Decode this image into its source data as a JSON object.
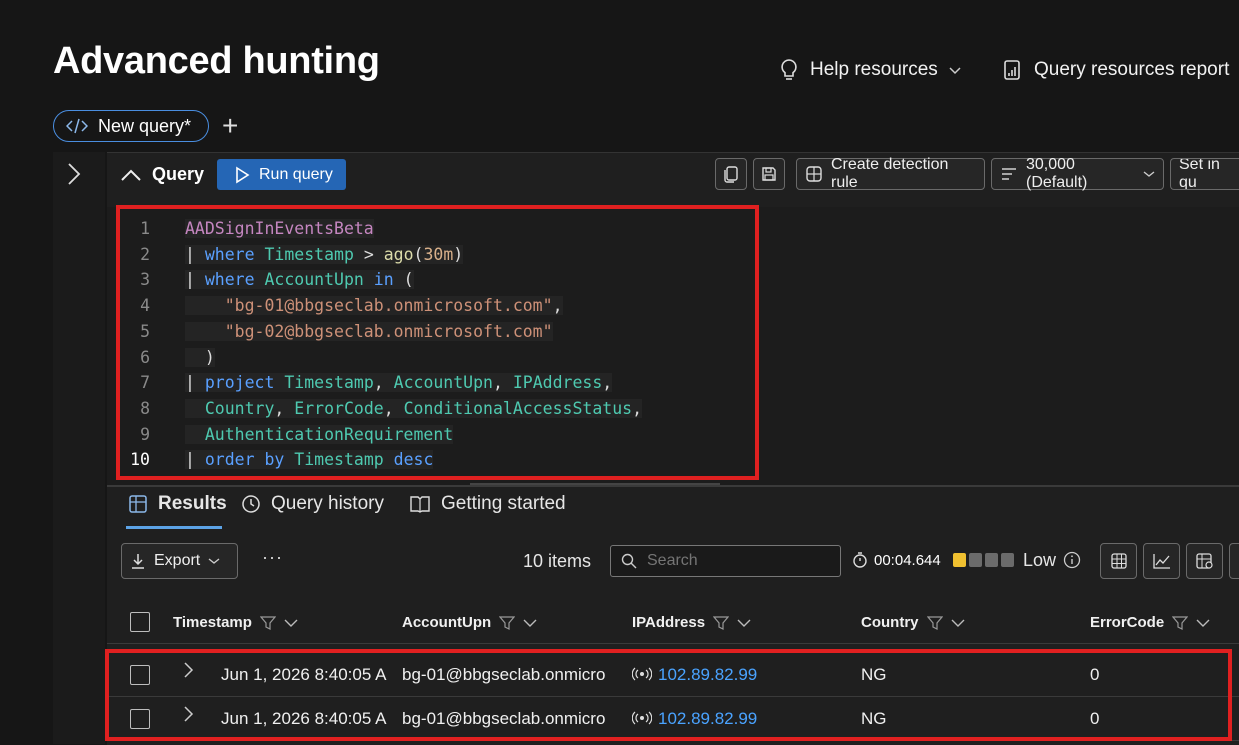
{
  "page": {
    "title": "Advanced hunting",
    "help_resources": "Help resources",
    "query_resources_report": "Query resources report"
  },
  "tab": {
    "label": "New query*"
  },
  "query_toolbar": {
    "query_label": "Query",
    "run_query": "Run query",
    "create_detection_rule": "Create detection rule",
    "limit": "30,000 (Default)",
    "set_in_query": "Set in qu"
  },
  "editor": {
    "line_numbers": [
      "1",
      "2",
      "3",
      "4",
      "5",
      "6",
      "7",
      "8",
      "9",
      "10"
    ],
    "lines": [
      [
        {
          "t": "AADSignInEventsBeta",
          "c": "tbl"
        }
      ],
      [
        {
          "t": "| ",
          "c": "pl"
        },
        {
          "t": "where ",
          "c": "kw"
        },
        {
          "t": "Timestamp ",
          "c": "id"
        },
        {
          "t": "> ",
          "c": "pl"
        },
        {
          "t": "ago",
          "c": "fn"
        },
        {
          "t": "(",
          "c": "pl"
        },
        {
          "t": "30m",
          "c": "num"
        },
        {
          "t": ")",
          "c": "pl"
        }
      ],
      [
        {
          "t": "| ",
          "c": "pl"
        },
        {
          "t": "where ",
          "c": "kw"
        },
        {
          "t": "AccountUpn ",
          "c": "id"
        },
        {
          "t": "in ",
          "c": "kw"
        },
        {
          "t": "(",
          "c": "pl"
        }
      ],
      [
        {
          "t": "    \"bg-01@bbgseclab.onmicrosoft.com\"",
          "c": "str"
        },
        {
          "t": ",",
          "c": "pl"
        }
      ],
      [
        {
          "t": "    \"bg-02@bbgseclab.onmicrosoft.com\"",
          "c": "str"
        }
      ],
      [
        {
          "t": "  )",
          "c": "pl"
        }
      ],
      [
        {
          "t": "| ",
          "c": "pl"
        },
        {
          "t": "project ",
          "c": "kw"
        },
        {
          "t": "Timestamp",
          "c": "id"
        },
        {
          "t": ", ",
          "c": "pl"
        },
        {
          "t": "AccountUpn",
          "c": "id"
        },
        {
          "t": ", ",
          "c": "pl"
        },
        {
          "t": "IPAddress",
          "c": "id"
        },
        {
          "t": ",",
          "c": "pl"
        }
      ],
      [
        {
          "t": "  ",
          "c": "pl"
        },
        {
          "t": "Country",
          "c": "id"
        },
        {
          "t": ", ",
          "c": "pl"
        },
        {
          "t": "ErrorCode",
          "c": "id"
        },
        {
          "t": ", ",
          "c": "pl"
        },
        {
          "t": "ConditionalAccessStatus",
          "c": "id"
        },
        {
          "t": ",",
          "c": "pl"
        }
      ],
      [
        {
          "t": "  ",
          "c": "pl"
        },
        {
          "t": "AuthenticationRequirement",
          "c": "id"
        }
      ],
      [
        {
          "t": "| ",
          "c": "pl"
        },
        {
          "t": "order ",
          "c": "kw"
        },
        {
          "t": "by ",
          "c": "kw"
        },
        {
          "t": "Timestamp ",
          "c": "id"
        },
        {
          "t": "desc",
          "c": "kw"
        }
      ]
    ]
  },
  "results_tabs": {
    "results": "Results",
    "query_history": "Query history",
    "getting_started": "Getting started"
  },
  "results_toolbar": {
    "export": "Export",
    "more": "···",
    "items_count": "10 items",
    "search_placeholder": "Search",
    "duration": "00:04.644",
    "resource_level": "Low",
    "level_fraction": 0.25
  },
  "table": {
    "columns": [
      "Timestamp",
      "AccountUpn",
      "IPAddress",
      "Country",
      "ErrorCode"
    ],
    "rows": [
      {
        "timestamp": "Jun 1, 2026 8:40:05 A",
        "account": "bg-01@bbgseclab.onmicro",
        "ip": "102.89.82.99",
        "country": "NG",
        "error": "0"
      },
      {
        "timestamp": "Jun 1, 2026 8:40:05 A",
        "account": "bg-01@bbgseclab.onmicro",
        "ip": "102.89.82.99",
        "country": "NG",
        "error": "0"
      }
    ]
  },
  "colors": {
    "accent": "#2566b5",
    "highlight_box": "#e02020",
    "link": "#4aa3ff",
    "level_active": "#f0c030"
  }
}
